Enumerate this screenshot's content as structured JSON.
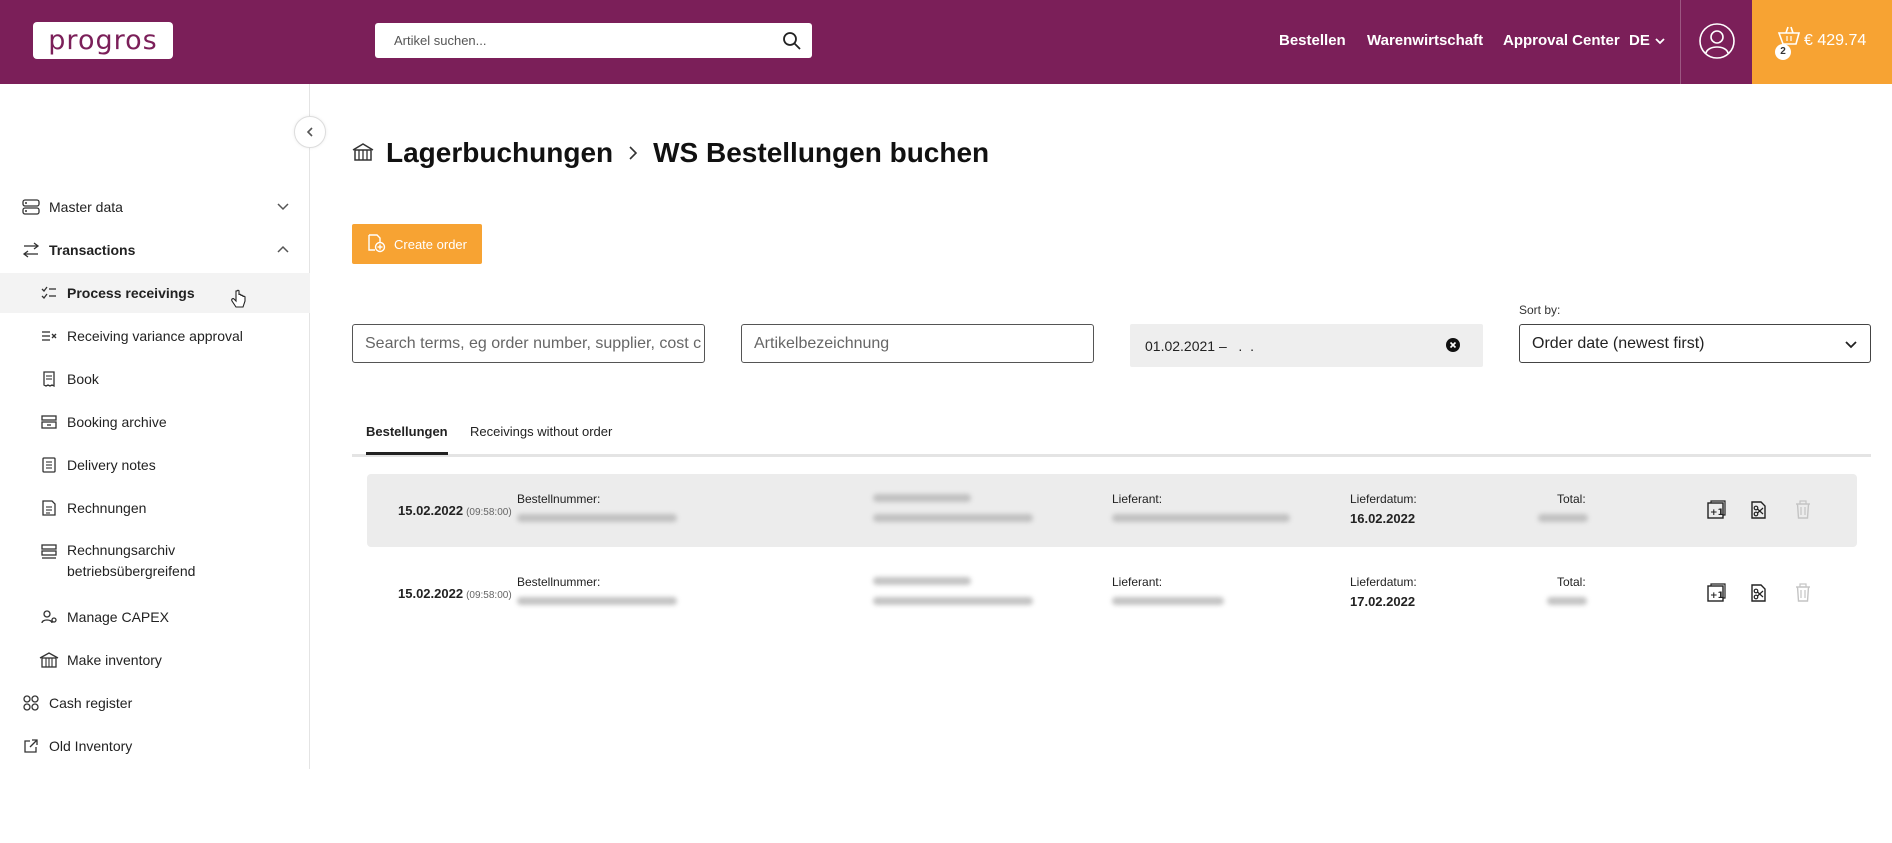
{
  "header": {
    "logo_text": "progros",
    "search_placeholder": "Artikel suchen...",
    "nav": [
      "Bestellen",
      "Warenwirtschaft",
      "Approval Center"
    ],
    "language": "DE",
    "cart_count": "2",
    "cart_amount": "€ 429.74"
  },
  "sidebar": {
    "items": [
      {
        "label": "Master data",
        "icon": "server-icon"
      },
      {
        "label": "Transactions",
        "icon": "transfer-arrows-icon"
      },
      {
        "label": "Process receivings",
        "icon": "checklist-icon"
      },
      {
        "label": "Receiving variance approval",
        "icon": "variance-list-icon"
      },
      {
        "label": "Book",
        "icon": "receipt-icon"
      },
      {
        "label": "Booking archive",
        "icon": "archive-icon"
      },
      {
        "label": "Delivery notes",
        "icon": "document-icon"
      },
      {
        "label": "Rechnungen",
        "icon": "invoice-icon"
      },
      {
        "label": "Rechnungsarchiv",
        "label2": "betriebsübergreifend",
        "icon": "archive-stack-icon"
      },
      {
        "label": "Manage CAPEX",
        "icon": "people-gear-icon"
      },
      {
        "label": "Make inventory",
        "icon": "warehouse-icon"
      },
      {
        "label": "Cash register",
        "icon": "grid-circles-icon"
      },
      {
        "label": "Old Inventory",
        "icon": "external-link-icon"
      }
    ]
  },
  "page": {
    "breadcrumb": [
      "Lagerbuchungen",
      "WS Bestellungen buchen"
    ],
    "create_order_label": "Create order",
    "filters": {
      "search_placeholder": "Search terms, eg order number, supplier, cost c",
      "article_placeholder": "Artikelbezeichnung",
      "date_range": "01.02.2021 –   .  .",
      "sort_label": "Sort by:",
      "sort_value": "Order date (newest first)"
    },
    "tabs": [
      "Bestellungen",
      "Receivings without order"
    ]
  },
  "orders": {
    "labels": {
      "order_number": "Bestellnummer:",
      "supplier": "Lieferant:",
      "delivery_date": "Lieferdatum:",
      "total": "Total:"
    },
    "rows": [
      {
        "date": "15.02.2022",
        "time": "(09:58:00)",
        "delivery_date": "16.02.2022"
      },
      {
        "date": "15.02.2022",
        "time": "(09:58:00)",
        "delivery_date": "17.02.2022"
      }
    ]
  },
  "colors": {
    "brand": "#7b1f59",
    "accent": "#f7a333"
  }
}
